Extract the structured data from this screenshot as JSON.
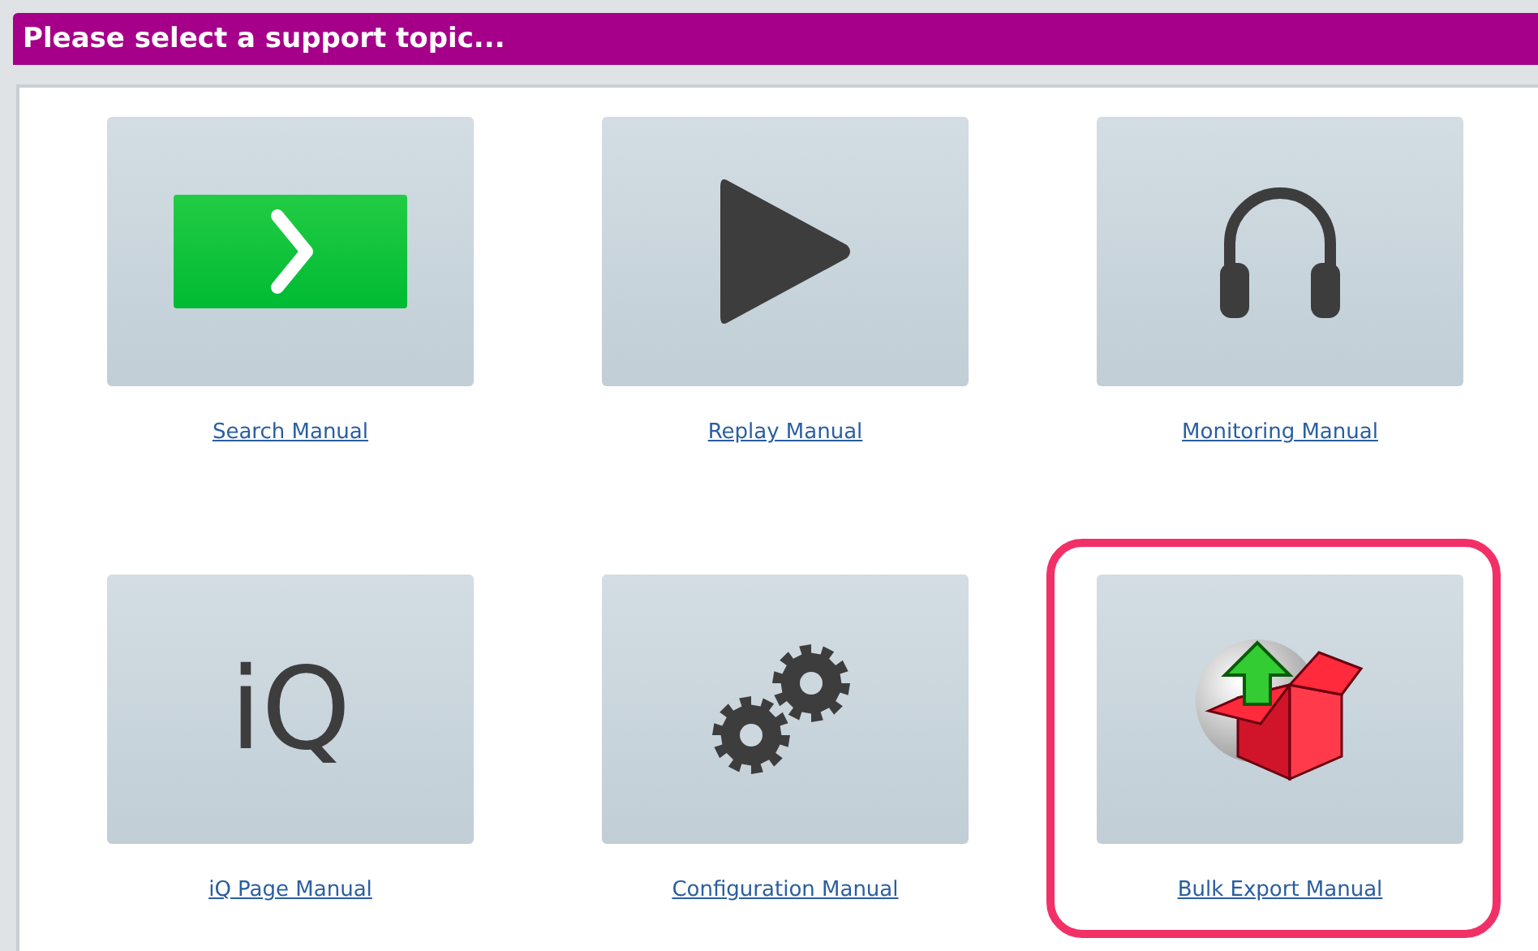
{
  "header": {
    "title": "Please select a support topic..."
  },
  "topics": [
    {
      "kind": "go-arrow",
      "label": "Search Manual",
      "highlighted": false
    },
    {
      "kind": "play",
      "label": "Replay Manual",
      "highlighted": false
    },
    {
      "kind": "headphones",
      "label": "Monitoring Manual",
      "highlighted": false
    },
    {
      "kind": "text",
      "text": "iQ",
      "label": "iQ Page Manual",
      "highlighted": false
    },
    {
      "kind": "gears",
      "label": "Configuration Manual",
      "highlighted": false
    },
    {
      "kind": "export-box",
      "label": "Bulk Export Manual",
      "highlighted": true
    }
  ]
}
